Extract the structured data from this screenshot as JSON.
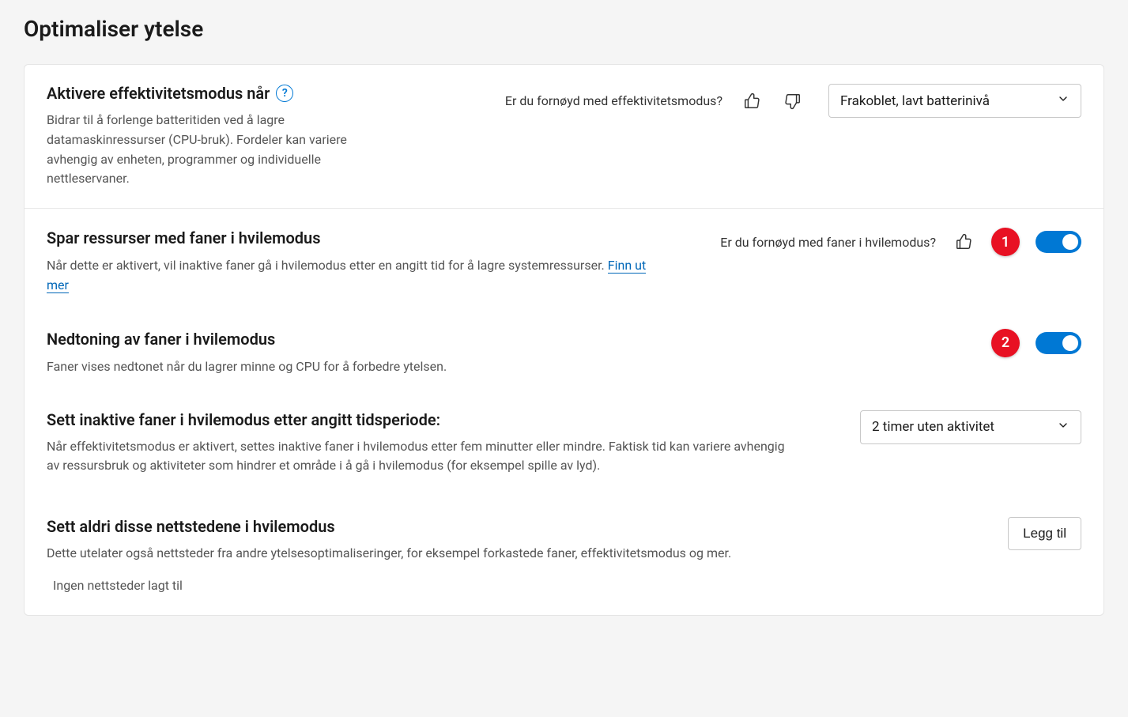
{
  "page": {
    "title": "Optimaliser ytelse"
  },
  "efficiency": {
    "title": "Aktivere effektivitetsmodus når",
    "desc": "Bidrar til å forlenge batteritiden ved å lagre datamaskinressurser (CPU-bruk). Fordeler kan variere avhengig av enheten, programmer og individuelle nettleservaner.",
    "feedback_prompt": "Er du fornøyd med effektivitetsmodus?",
    "dropdown_value": "Frakoblet, lavt batterinivå"
  },
  "sleeping_tabs": {
    "title": "Spar ressurser med faner i hvilemodus",
    "desc_prefix": "Når dette er aktivert, vil inaktive faner gå i hvilemodus etter en angitt tid for å lagre systemressurser. ",
    "learn_more": "Finn ut mer",
    "feedback_prompt": "Er du fornøyd med faner i hvilemodus?",
    "badge": "1"
  },
  "fade_tabs": {
    "title": "Nedtoning av faner i hvilemodus",
    "desc": "Faner vises nedtonet når du lagrer minne og CPU for å forbedre ytelsen.",
    "badge": "2"
  },
  "sleep_timeout": {
    "title": "Sett inaktive faner i hvilemodus etter angitt tidsperiode:",
    "desc": "Når effektivitetsmodus er aktivert, settes inaktive faner i hvilemodus etter fem minutter eller mindre. Faktisk tid kan variere avhengig av ressursbruk og aktiviteter som hindrer et område i å gå i hvilemodus (for eksempel spille av lyd).",
    "dropdown_value": "2 timer uten aktivitet"
  },
  "never_sleep": {
    "title": "Sett aldri disse nettstedene i hvilemodus",
    "desc": "Dette utelater også nettsteder fra andre ytelsesoptimaliseringer, for eksempel forkastede faner, effektivitetsmodus og mer.",
    "add_button": "Legg til",
    "empty": "Ingen nettsteder lagt til"
  }
}
